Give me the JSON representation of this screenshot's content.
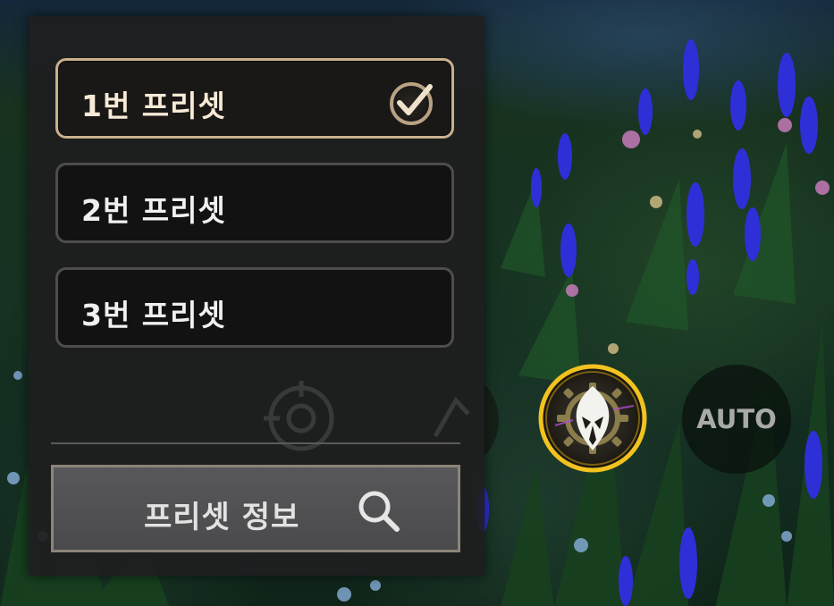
{
  "presets": [
    {
      "label": "1번 프리셋",
      "selected": true
    },
    {
      "label": "2번 프리셋",
      "selected": false
    },
    {
      "label": "3번 프리셋",
      "selected": false
    }
  ],
  "info_button": {
    "label": "프리셋 정보",
    "icon": "search-icon"
  },
  "hud": {
    "auto_label": "AUTO",
    "hero_icon": "helmet-icon"
  },
  "colors": {
    "selected_border": "#c9b08d",
    "panel_bg": "#1e1e1f",
    "hero_ring": "#f2c21f"
  }
}
